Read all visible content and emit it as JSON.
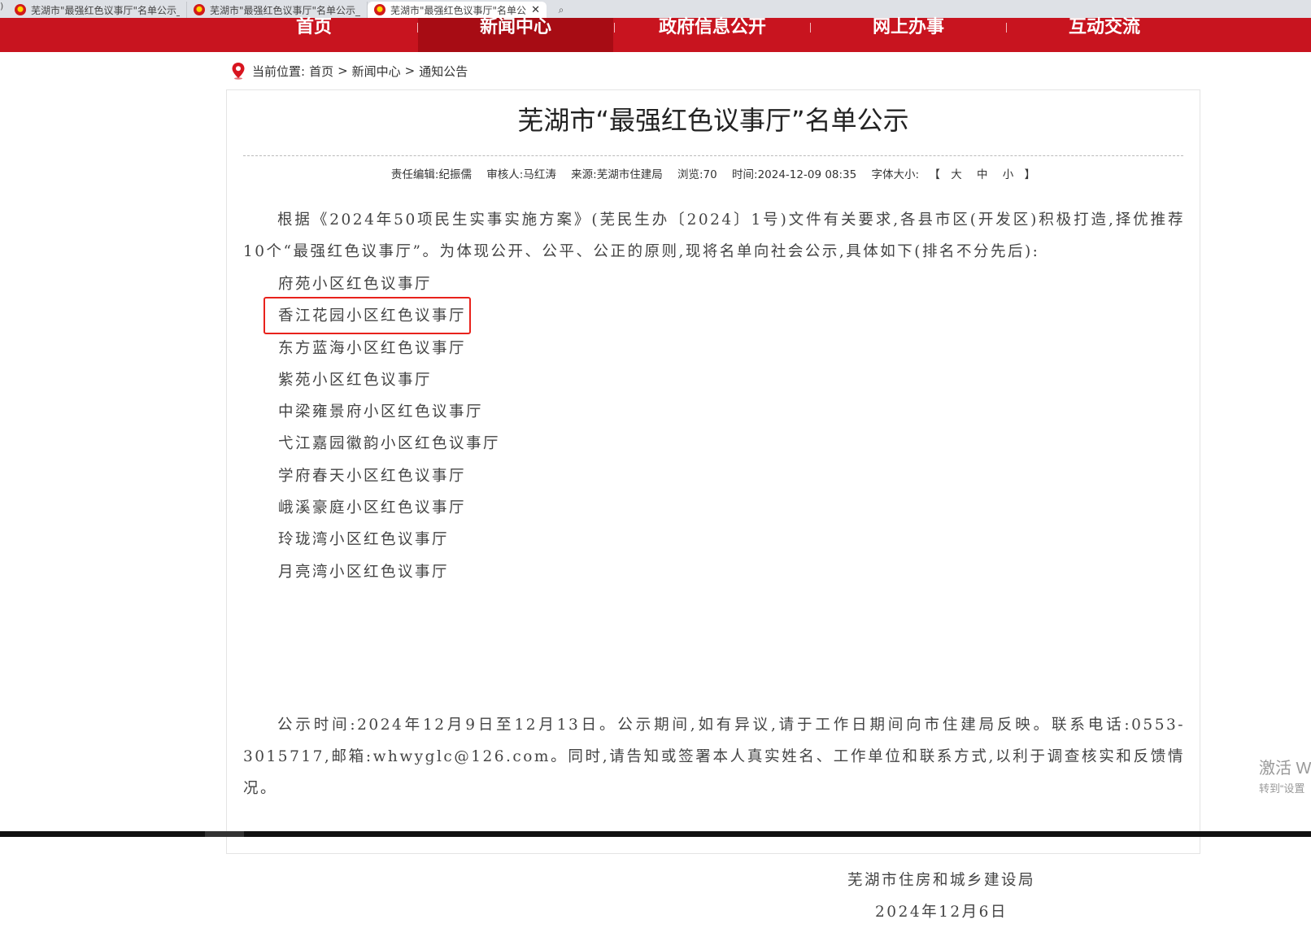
{
  "browser": {
    "prev_edge": ")",
    "tabs": [
      {
        "title": "芜湖市\"最强红色议事厅\"名单公示_"
      },
      {
        "title": "芜湖市\"最强红色议事厅\"名单公示_"
      },
      {
        "title": "芜湖市\"最强红色议事厅\"名单公示",
        "close": "✕"
      }
    ],
    "search_icon": "⌕"
  },
  "nav": {
    "items": [
      {
        "label": "首页"
      },
      {
        "label": "新闻中心"
      },
      {
        "label": "政府信息公开"
      },
      {
        "label": "网上办事"
      },
      {
        "label": "互动交流"
      }
    ],
    "active_color": "#a70c14",
    "bar_color": "#c8141f"
  },
  "breadcrumb": {
    "label": "当前位置:",
    "home": "首页",
    "sep1": ">",
    "section": "新闻中心",
    "sep2": ">",
    "current": "通知公告"
  },
  "article": {
    "title": "芜湖市“最强红色议事厅”名单公示",
    "meta": {
      "editor": "责任编辑:纪振儒",
      "reviewer": "审核人:马红涛",
      "source": "来源:芜湖市住建局",
      "views": "浏览:70",
      "time": "时间:2024-12-09 08:35",
      "fontsize_label": "字体大小:",
      "bracket_open": "【",
      "size_large": "大",
      "size_medium": "中",
      "size_small": "小",
      "bracket_close": "】"
    },
    "intro": "根据《2024年50项民生实事实施方案》(芜民生办〔2024〕1号)文件有关要求,各县市区(开发区)积极打造,择优推荐10个“最强红色议事厅”。为体现公开、公平、公正的原则,现将名单向社会公示,具体如下(排名不分先后):",
    "list": [
      "府苑小区红色议事厅",
      "香江花园小区红色议事厅",
      "东方蓝海小区红色议事厅",
      "紫苑小区红色议事厅",
      "中梁雍景府小区红色议事厅",
      "弋江嘉园徽韵小区红色议事厅",
      "学府春天小区红色议事厅",
      "峨溪豪庭小区红色议事厅",
      "玲珑湾小区红色议事厅",
      "月亮湾小区红色议事厅"
    ],
    "notice": "公示时间:2024年12月9日至12月13日。公示期间,如有异议,请于工作日期间向市住建局反映。联系电话:0553-3015717,邮箱:whwyglc@126.com。同时,请告知或签署本人真实姓名、工作单位和联系方式,以利于调查核实和反馈情况。",
    "signature_org": "芜湖市住房和城乡建设局",
    "signature_date": "2024年12月6日"
  },
  "watermark": {
    "line1": "激活 W",
    "line2": "转到“设置"
  }
}
